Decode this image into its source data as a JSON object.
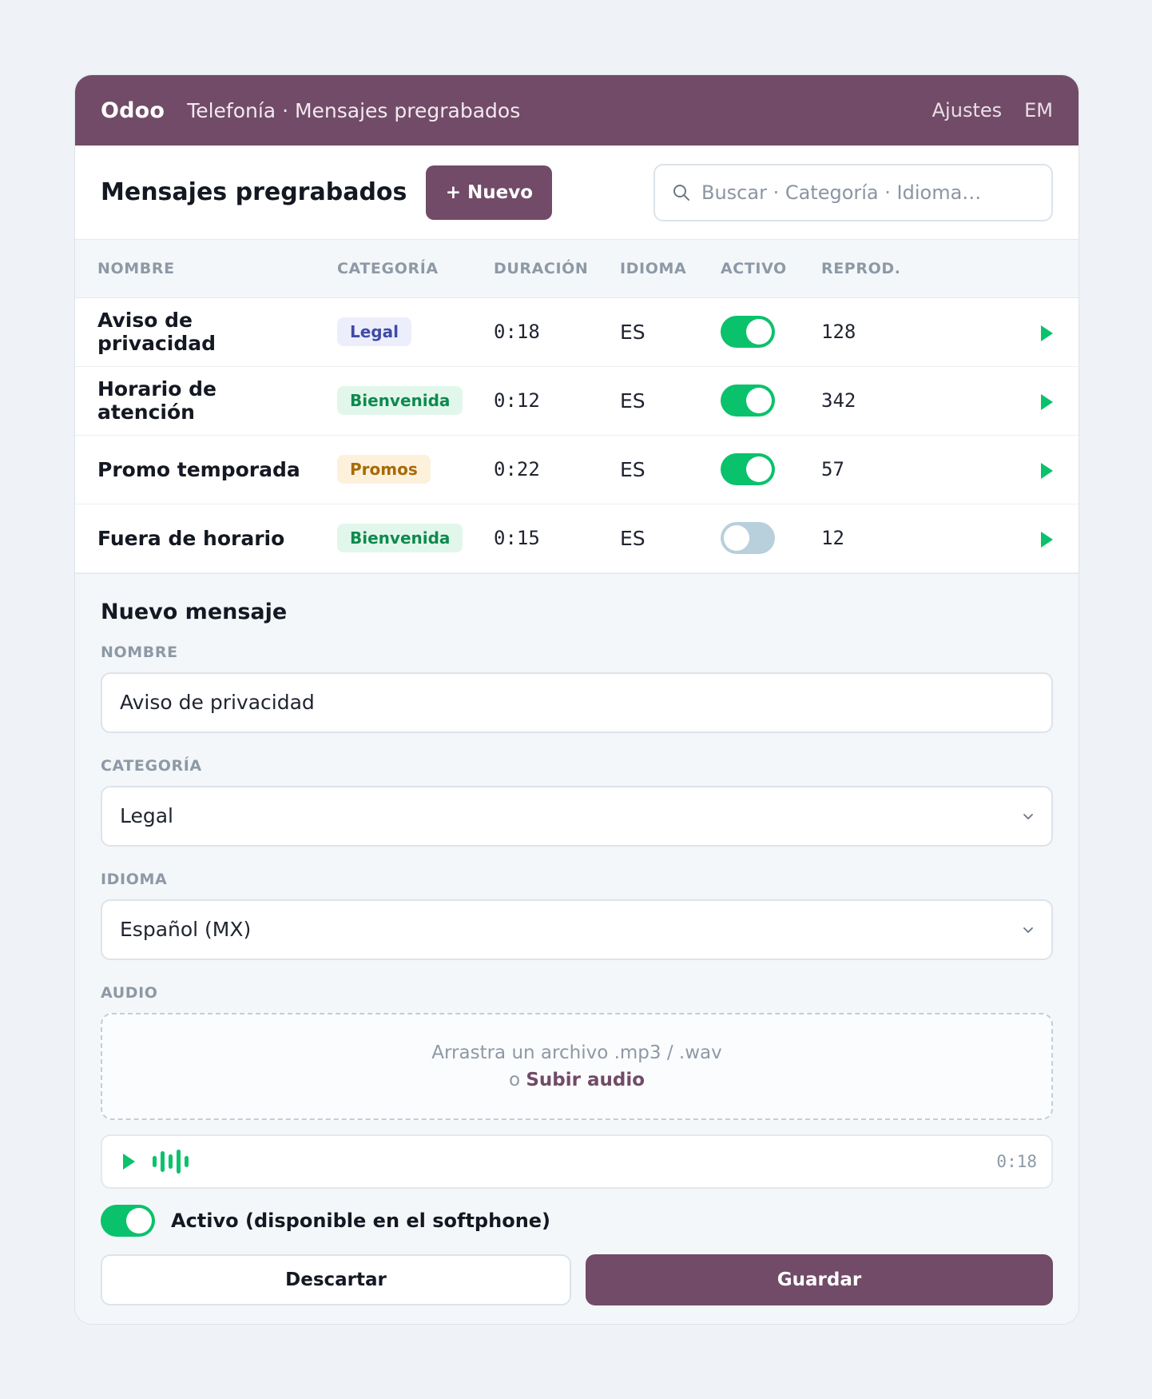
{
  "topbar": {
    "brand": "Odoo",
    "breadcrumb": "Telefonía · Mensajes pregrabados",
    "settings": "Ajustes",
    "avatar": "EM",
    "color": "#714b67"
  },
  "control": {
    "title": "Mensajes pregrabados",
    "new_label": "+ Nuevo",
    "search_placeholder": "Buscar · Categoría · Idioma…"
  },
  "table": {
    "columns": [
      "NOMBRE",
      "CATEGORÍA",
      "DURACIÓN",
      "IDIOMA",
      "ACTIVO",
      "REPROD."
    ],
    "rows": [
      {
        "name": "Aviso de privacidad",
        "category": "Legal",
        "duration": "0:18",
        "language": "ES",
        "active": true,
        "plays": "128"
      },
      {
        "name": "Horario de atención",
        "category": "Bienvenida",
        "duration": "0:12",
        "language": "ES",
        "active": true,
        "plays": "342"
      },
      {
        "name": "Promo temporada",
        "category": "Promos",
        "duration": "0:22",
        "language": "ES",
        "active": true,
        "plays": "57"
      },
      {
        "name": "Fuera de horario",
        "category": "Bienvenida",
        "duration": "0:15",
        "language": "ES",
        "active": false,
        "plays": "12"
      }
    ]
  },
  "badge_colors": {
    "Legal": {
      "bg": "#eceefc",
      "fg": "#3f4aa8"
    },
    "Bienvenida": {
      "bg": "#e2f7ec",
      "fg": "#0e8a4e"
    },
    "Promos": {
      "bg": "#fdf1dc",
      "fg": "#a86a06"
    }
  },
  "form": {
    "title": "Nuevo mensaje",
    "name_label": "NOMBRE",
    "name_value": "Aviso de privacidad",
    "category_label": "CATEGORÍA",
    "category_value": "Legal",
    "language_label": "IDIOMA",
    "language_value": "Español (MX)",
    "audio_label": "AUDIO",
    "drop_text": "Arrastra un archivo .mp3 / .wav",
    "drop_or": "o",
    "upload_label": "Subir audio",
    "player_time": "0:18",
    "active_label": "Activo (disponible en el softphone)",
    "active": true,
    "discard_label": "Descartar",
    "save_label": "Guardar"
  },
  "icons": {
    "search": "search-icon",
    "play": "play-icon",
    "chevron": "chevron-down-icon",
    "waveform": "waveform-icon"
  }
}
